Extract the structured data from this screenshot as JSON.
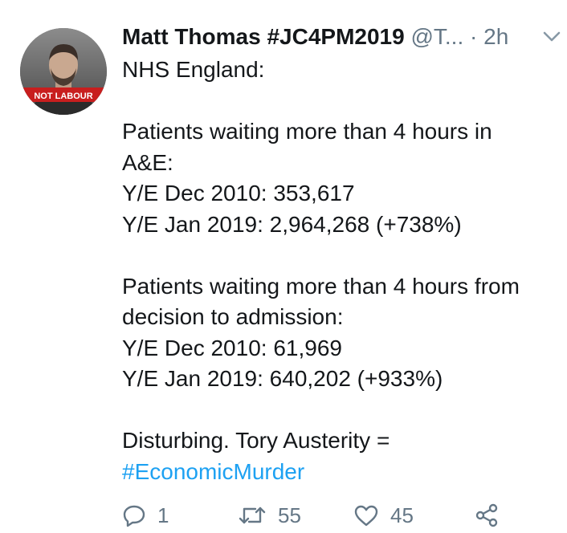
{
  "tweet": {
    "author_name": "Matt Thomas #JC4PM2019",
    "handle": "@T...",
    "separator": "·",
    "time": "2h",
    "avatar_text": "NOT LABOUR",
    "lines": [
      "NHS England:",
      "",
      "Patients waiting more than 4 hours in",
      "A&E:",
      "Y/E Dec 2010: 353,617",
      "Y/E Jan 2019: 2,964,268 (+738%)",
      "",
      "Patients waiting more than 4 hours from",
      "decision to admission:",
      "Y/E Dec 2010: 61,969",
      "Y/E Jan 2019: 640,202 (+933%)",
      "",
      "Disturbing. Tory Austerity ="
    ],
    "hashtag": "#EconomicMurder"
  },
  "actions": {
    "reply_count": "1",
    "retweet_count": "55",
    "like_count": "45"
  },
  "colors": {
    "text": "#14171a",
    "secondary": "#657786",
    "link": "#1da1f2"
  },
  "icons": [
    "chevron-down-icon",
    "reply-icon",
    "retweet-icon",
    "like-icon",
    "share-icon"
  ]
}
